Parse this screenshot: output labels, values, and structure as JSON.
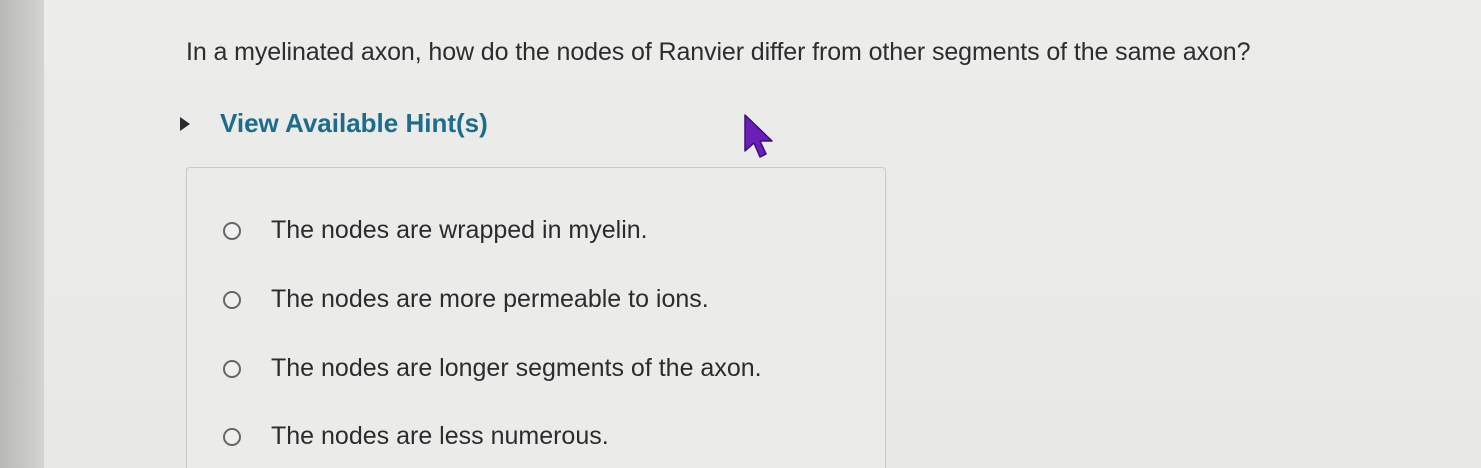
{
  "question": {
    "text": "In a myelinated axon, how do the nodes of Ranvier differ from other segments of the same axon?"
  },
  "hints": {
    "label": "View Available Hint(s)"
  },
  "options": [
    {
      "label": "The nodes are wrapped in myelin."
    },
    {
      "label": "The nodes are more permeable to ions."
    },
    {
      "label": "The nodes are longer segments of the axon."
    },
    {
      "label": "The nodes are less numerous."
    }
  ],
  "colors": {
    "hint_link": "#1f6b8c",
    "cursor": "#6a1fb8"
  },
  "icons": {
    "hint_toggle": "caret-right-icon",
    "pointer": "mouse-cursor-icon"
  }
}
